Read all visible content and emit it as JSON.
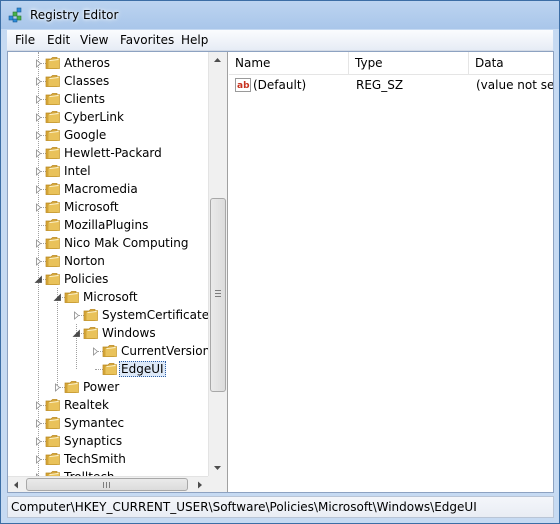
{
  "window": {
    "title": "Registry Editor"
  },
  "menu": [
    "File",
    "Edit",
    "View",
    "Favorites",
    "Help"
  ],
  "tree": [
    {
      "label": "Atheros",
      "depth": 0,
      "expander": "collapsed"
    },
    {
      "label": "Classes",
      "depth": 0,
      "expander": "collapsed"
    },
    {
      "label": "Clients",
      "depth": 0,
      "expander": "collapsed"
    },
    {
      "label": "CyberLink",
      "depth": 0,
      "expander": "collapsed"
    },
    {
      "label": "Google",
      "depth": 0,
      "expander": "collapsed"
    },
    {
      "label": "Hewlett-Packard",
      "depth": 0,
      "expander": "collapsed"
    },
    {
      "label": "Intel",
      "depth": 0,
      "expander": "collapsed"
    },
    {
      "label": "Macromedia",
      "depth": 0,
      "expander": "collapsed"
    },
    {
      "label": "Microsoft",
      "depth": 0,
      "expander": "collapsed"
    },
    {
      "label": "MozillaPlugins",
      "depth": 0,
      "expander": "none"
    },
    {
      "label": "Nico Mak Computing",
      "depth": 0,
      "expander": "collapsed"
    },
    {
      "label": "Norton",
      "depth": 0,
      "expander": "collapsed"
    },
    {
      "label": "Policies",
      "depth": 0,
      "expander": "expanded"
    },
    {
      "label": "Microsoft",
      "depth": 1,
      "expander": "expanded"
    },
    {
      "label": "SystemCertificates",
      "depth": 2,
      "expander": "collapsed"
    },
    {
      "label": "Windows",
      "depth": 2,
      "expander": "expanded"
    },
    {
      "label": "CurrentVersion",
      "depth": 3,
      "expander": "collapsed"
    },
    {
      "label": "EdgeUI",
      "depth": 3,
      "expander": "none",
      "selected": true
    },
    {
      "label": "Power",
      "depth": 1,
      "expander": "collapsed"
    },
    {
      "label": "Realtek",
      "depth": 0,
      "expander": "collapsed"
    },
    {
      "label": "Symantec",
      "depth": 0,
      "expander": "collapsed"
    },
    {
      "label": "Synaptics",
      "depth": 0,
      "expander": "collapsed"
    },
    {
      "label": "TechSmith",
      "depth": 0,
      "expander": "collapsed"
    },
    {
      "label": "Trolltech",
      "depth": 0,
      "expander": "collapsed"
    }
  ],
  "list": {
    "columns": [
      "Name",
      "Type",
      "Data"
    ],
    "rows": [
      {
        "icon": "string-value-icon",
        "name": "(Default)",
        "type": "REG_SZ",
        "data": "(value not set)"
      }
    ]
  },
  "status": {
    "path": "Computer\\HKEY_CURRENT_USER\\Software\\Policies\\Microsoft\\Windows\\EdgeUI"
  },
  "colors": {
    "folder": "#e9c25a",
    "selection": "#dde9f8",
    "title_bar": "#a9c6ea"
  }
}
